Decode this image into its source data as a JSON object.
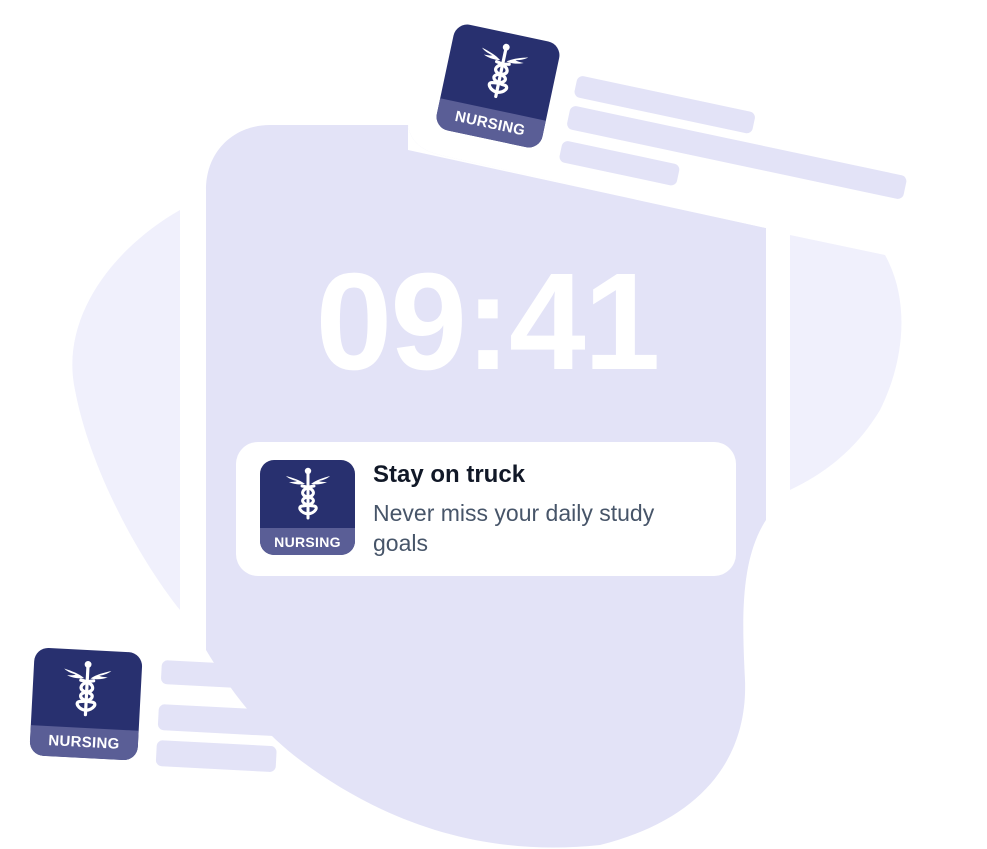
{
  "lockscreen": {
    "time": "09:41"
  },
  "notification": {
    "title": "Stay on truck",
    "body": "Never miss your daily study goals",
    "app_label": "NURSING"
  },
  "floating_icons": {
    "top_label": "NURSING",
    "bottom_label": "NURSING"
  },
  "colors": {
    "background": "#ffffff",
    "blob_light": "#f0f0fc",
    "phone": "#e3e3f7",
    "icon_dark": "#28306f",
    "icon_strip": "#5a5e96",
    "title_text": "#111827",
    "body_text": "#475569"
  },
  "icons": {
    "app_emblem": "caduceus-icon"
  }
}
